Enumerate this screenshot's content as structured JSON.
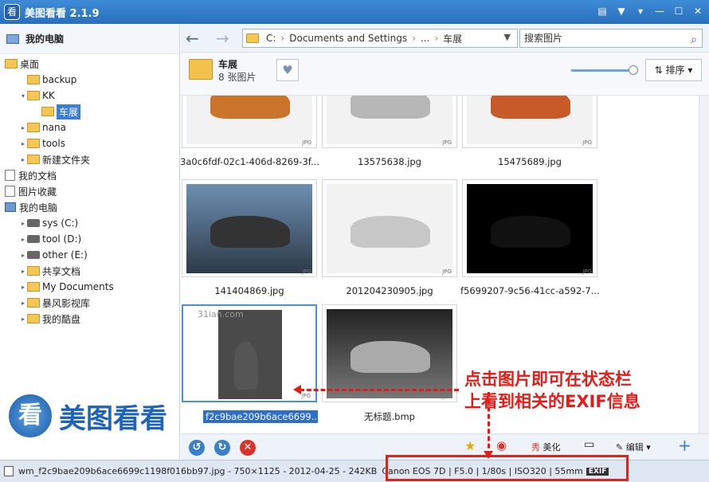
{
  "app": {
    "title": "美图看看 2.1.9",
    "icon_char": "看"
  },
  "window_buttons": [
    "message-icon",
    "shirt-icon",
    "menu-icon",
    "minimize-icon",
    "maximize-icon",
    "close-icon"
  ],
  "sidebar": {
    "header": "我的电脑",
    "tree": [
      {
        "label": "桌面",
        "type": "folder",
        "level": 0
      },
      {
        "label": "backup",
        "type": "folder",
        "level": 1
      },
      {
        "label": "KK",
        "type": "folder",
        "level": 1
      },
      {
        "label": "车展",
        "type": "folder",
        "level": 2,
        "selected": true
      },
      {
        "label": "nana",
        "type": "folder",
        "level": 1
      },
      {
        "label": "tools",
        "type": "folder",
        "level": 1
      },
      {
        "label": "新建文件夹",
        "type": "folder",
        "level": 1
      },
      {
        "label": "我的文档",
        "type": "doc",
        "level": 0
      },
      {
        "label": "图片收藏",
        "type": "doc",
        "level": 0
      },
      {
        "label": "我的电脑",
        "type": "pc",
        "level": 0
      },
      {
        "label": "sys (C:)",
        "type": "drive",
        "level": 1
      },
      {
        "label": "tool (D:)",
        "type": "drive",
        "level": 1
      },
      {
        "label": "other (E:)",
        "type": "drive",
        "level": 1
      },
      {
        "label": "共享文档",
        "type": "folder",
        "level": 1
      },
      {
        "label": "My Documents",
        "type": "folder",
        "level": 1
      },
      {
        "label": "暴风影视库",
        "type": "folder",
        "level": 1
      },
      {
        "label": "我的酷盘",
        "type": "folder",
        "level": 1
      }
    ]
  },
  "address": {
    "drive": "C:",
    "seg1": "Documents and Settings",
    "sep": "...",
    "seg2": "车展"
  },
  "search": {
    "placeholder": "搜索图片"
  },
  "folder_info": {
    "name": "车展",
    "count": "8 张图片"
  },
  "sort_label": "排序",
  "thumbnails": [
    {
      "caption": "3a0c6fdf-02c1-406d-8269-3f...",
      "color": "#c9742a"
    },
    {
      "caption": "13575638.jpg",
      "color": "#b7b7b7"
    },
    {
      "caption": "15475689.jpg",
      "color": "#c85a2a"
    },
    {
      "caption": "141404869.jpg",
      "color": "#333"
    },
    {
      "caption": "201204230905.jpg",
      "color": "#c7c7c7"
    },
    {
      "caption": "f5699207-9c56-41cc-a592-7...",
      "color": "#111"
    },
    {
      "caption": "f2c9bae209b6ace6699...",
      "color": "#555"
    },
    {
      "caption": "无标题.bmp",
      "color": "#aaa"
    }
  ],
  "watermark": "31ian.com",
  "bottom_tools": {
    "beautify": "美化",
    "edit": "编辑"
  },
  "status": {
    "file": "wm_f2c9bae209b6ace6699c1198f016bb97.jpg - 750×1125 - 2012-04-25 - 242KB",
    "exif": "Canon EOS 7D | F5.0 | 1/80s | ISO320 | 55mm",
    "exif_badge": "EXIF"
  },
  "annotation": {
    "line1": "点击图片即可在状态栏",
    "line2": "上看到相关的EXIF信息"
  },
  "logo_text": "美图看看"
}
